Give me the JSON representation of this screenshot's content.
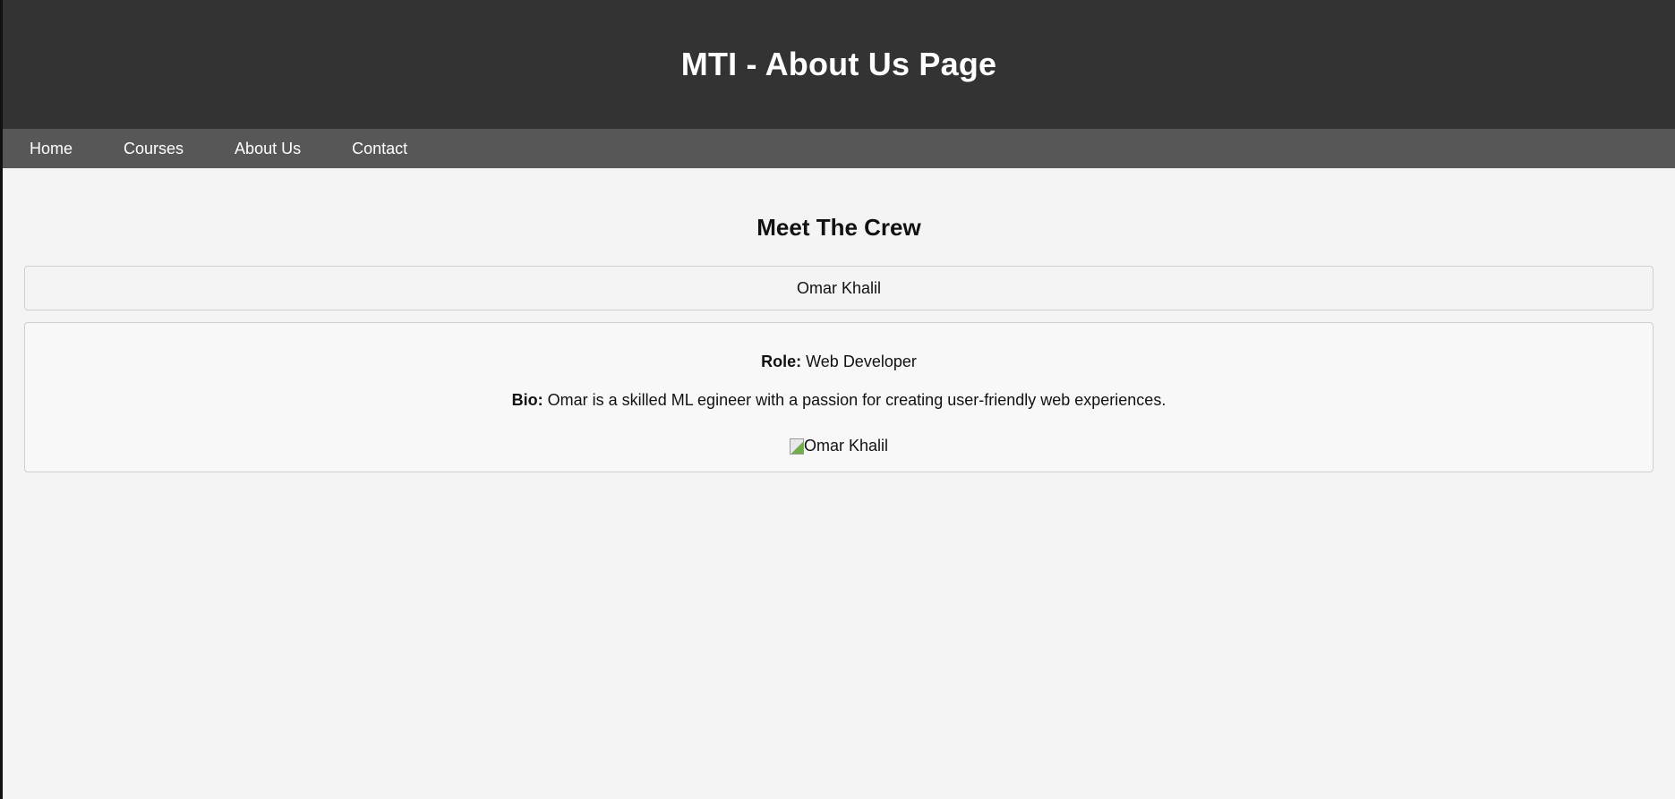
{
  "header": {
    "title": "MTI - About Us Page"
  },
  "nav": {
    "items": [
      {
        "label": "Home"
      },
      {
        "label": "Courses"
      },
      {
        "label": "About Us"
      },
      {
        "label": "Contact"
      }
    ]
  },
  "main": {
    "section_title": "Meet The Crew",
    "member": {
      "name": "Omar Khalil",
      "role_label": "Role:",
      "role_value": " Web Developer",
      "bio_label": "Bio:",
      "bio_value": " Omar is a skilled ML egineer with a passion for creating user-friendly web experiences.",
      "photo_alt": "Omar Khalil",
      "photo_icon": "broken-image-icon"
    }
  },
  "colors": {
    "header_bg": "#333333",
    "nav_bg": "#575757",
    "page_bg": "#f4f4f4",
    "card_border": "#cfcfcf"
  }
}
